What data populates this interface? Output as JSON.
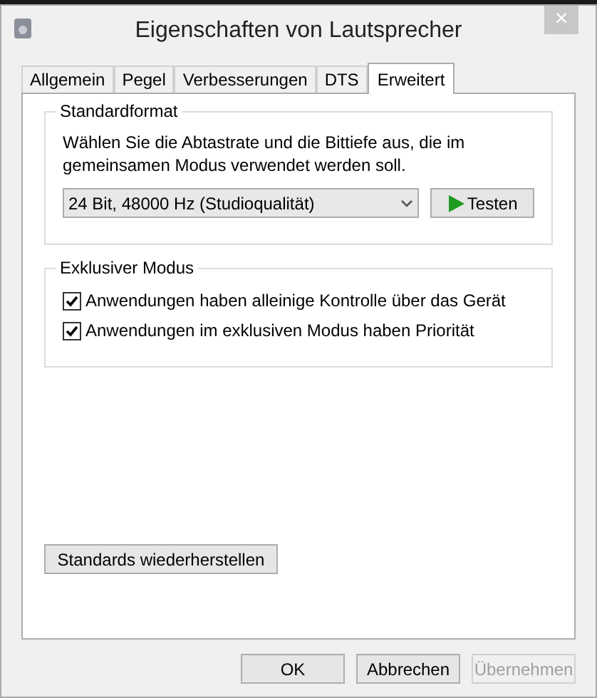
{
  "window": {
    "title": "Eigenschaften von Lautsprecher",
    "close": "×"
  },
  "tabs": [
    {
      "label": "Allgemein",
      "selected": false
    },
    {
      "label": "Pegel",
      "selected": false
    },
    {
      "label": "Verbesserungen",
      "selected": false
    },
    {
      "label": "DTS",
      "selected": false
    },
    {
      "label": "Erweitert",
      "selected": true
    }
  ],
  "standard_format": {
    "title": "Standardformat",
    "description": "Wählen Sie die Abtastrate und die Bittiefe aus, die im gemeinsamen Modus verwendet werden soll.",
    "format_value": "24 Bit, 48000 Hz (Studioqualität)",
    "test_button": "Testen"
  },
  "exclusive_mode": {
    "title": "Exklusiver Modus",
    "options": [
      {
        "label": "Anwendungen haben alleinige Kontrolle über das Gerät",
        "checked": true
      },
      {
        "label": "Anwendungen im exklusiven Modus haben Priorität",
        "checked": true
      }
    ]
  },
  "restore_button": "Standards wiederherstellen",
  "buttons": [
    {
      "label": "OK",
      "disabled": false
    },
    {
      "label": "Abbrechen",
      "disabled": false
    },
    {
      "label": "Übernehmen",
      "disabled": true
    }
  ]
}
